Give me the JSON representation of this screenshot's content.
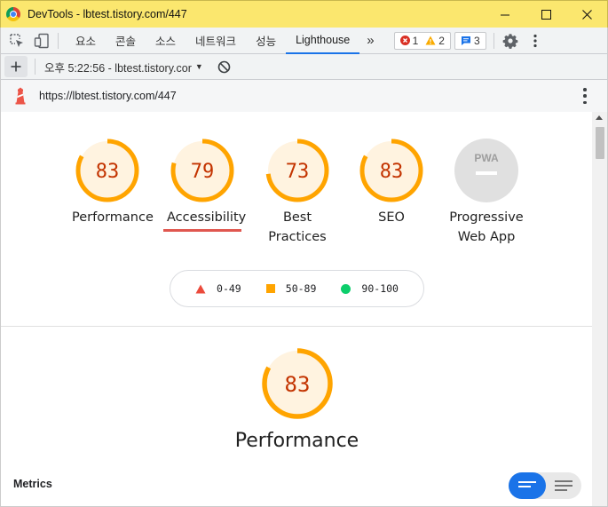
{
  "window": {
    "title": "DevTools - lbtest.tistory.com/447",
    "icons": [
      "chrome-icon",
      "minimize-icon",
      "maximize-icon",
      "close-icon"
    ]
  },
  "tabs": {
    "items": [
      {
        "label": "요소",
        "active": false
      },
      {
        "label": "콘솔",
        "active": false
      },
      {
        "label": "소스",
        "active": false
      },
      {
        "label": "네트워크",
        "active": false
      },
      {
        "label": "성능",
        "active": false
      },
      {
        "label": "Lighthouse",
        "active": true
      }
    ],
    "more": "»",
    "errors": "1",
    "warnings": "2",
    "messages": "3"
  },
  "toolbar2": {
    "report": "오후 5:22:56 - lbtest.tistory.cor",
    "caret": "▼"
  },
  "urlbar": {
    "url": "https://lbtest.tistory.com/447"
  },
  "scores": [
    {
      "id": "performance",
      "value": "83",
      "label": "Performance",
      "fraction": 0.83,
      "color": "#ffa400"
    },
    {
      "id": "accessibility",
      "value": "79",
      "label": "Accessibility",
      "fraction": 0.79,
      "color": "#ffa400",
      "selected": true
    },
    {
      "id": "best-practices",
      "value": "73",
      "label": "Best Practices",
      "fraction": 0.73,
      "color": "#ffa400"
    },
    {
      "id": "seo",
      "value": "83",
      "label": "SEO",
      "fraction": 0.83,
      "color": "#ffa400"
    },
    {
      "id": "pwa",
      "value": "PWA",
      "label": "Progressive Web App",
      "fraction": 0,
      "color": "#9e9e9e"
    }
  ],
  "legend": [
    {
      "range": "0-49",
      "shape": "triangle",
      "color": "#eb4a3b"
    },
    {
      "range": "50-89",
      "shape": "square",
      "color": "#ffa400"
    },
    {
      "range": "90-100",
      "shape": "circle",
      "color": "#0cce6b"
    }
  ],
  "section": {
    "score": "83",
    "fraction": 0.83,
    "title": "Performance",
    "metrics_label": "Metrics"
  },
  "colors": {
    "average": "#ffa400",
    "average_bg": "#fff3e0",
    "accent": "#1a73e8"
  }
}
